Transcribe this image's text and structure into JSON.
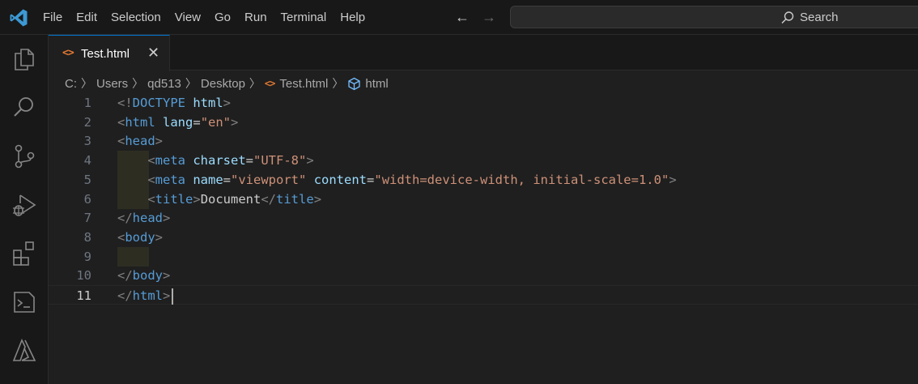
{
  "menu": [
    "File",
    "Edit",
    "Selection",
    "View",
    "Go",
    "Run",
    "Terminal",
    "Help"
  ],
  "search": {
    "label": "Search"
  },
  "activity_bar": [
    "explorer-icon",
    "search-icon",
    "source-control-icon",
    "run-debug-icon",
    "extensions-icon",
    "terminal-icon",
    "azure-icon"
  ],
  "tab": {
    "label": "Test.html",
    "close": "✕"
  },
  "breadcrumb": {
    "drive": "C:",
    "users": "Users",
    "user": "qd513",
    "folder": "Desktop",
    "file": "Test.html",
    "symbol": "html"
  },
  "editor": {
    "current_line": 11,
    "line_numbers": [
      "1",
      "2",
      "3",
      "4",
      "5",
      "6",
      "7",
      "8",
      "9",
      "10",
      "11"
    ],
    "lines": [
      [
        [
          "p",
          "<!"
        ],
        [
          "t",
          "DOCTYPE"
        ],
        [
          "x",
          " "
        ],
        [
          "a",
          "html"
        ],
        [
          "p",
          ">"
        ]
      ],
      [
        [
          "p",
          "<"
        ],
        [
          "t",
          "html"
        ],
        [
          "x",
          " "
        ],
        [
          "a",
          "lang"
        ],
        [
          "x",
          "="
        ],
        [
          "s",
          "\"en\""
        ],
        [
          "p",
          ">"
        ]
      ],
      [
        [
          "p",
          "<"
        ],
        [
          "t",
          "head"
        ],
        [
          "p",
          ">"
        ]
      ],
      [
        [
          "x",
          "    "
        ],
        [
          "p",
          "<"
        ],
        [
          "t",
          "meta"
        ],
        [
          "x",
          " "
        ],
        [
          "a",
          "charset"
        ],
        [
          "x",
          "="
        ],
        [
          "s",
          "\"UTF-8\""
        ],
        [
          "p",
          ">"
        ]
      ],
      [
        [
          "x",
          "    "
        ],
        [
          "p",
          "<"
        ],
        [
          "t",
          "meta"
        ],
        [
          "x",
          " "
        ],
        [
          "a",
          "name"
        ],
        [
          "x",
          "="
        ],
        [
          "s",
          "\"viewport\""
        ],
        [
          "x",
          " "
        ],
        [
          "a",
          "content"
        ],
        [
          "x",
          "="
        ],
        [
          "s",
          "\"width=device-width, initial-scale=1.0\""
        ],
        [
          "p",
          ">"
        ]
      ],
      [
        [
          "x",
          "    "
        ],
        [
          "p",
          "<"
        ],
        [
          "t",
          "title"
        ],
        [
          "p",
          ">"
        ],
        [
          "x",
          "Document"
        ],
        [
          "p",
          "</"
        ],
        [
          "t",
          "title"
        ],
        [
          "p",
          ">"
        ]
      ],
      [
        [
          "p",
          "</"
        ],
        [
          "t",
          "head"
        ],
        [
          "p",
          ">"
        ]
      ],
      [
        [
          "p",
          "<"
        ],
        [
          "t",
          "body"
        ],
        [
          "p",
          ">"
        ]
      ],
      [],
      [
        [
          "p",
          "</"
        ],
        [
          "t",
          "body"
        ],
        [
          "p",
          ">"
        ]
      ],
      [
        [
          "p",
          "</"
        ],
        [
          "t",
          "html"
        ],
        [
          "p",
          ">"
        ]
      ]
    ]
  },
  "colors": {
    "accent": "#0078d4",
    "vscode_logo": "#3c99d4",
    "tag": "#569cd6",
    "attribute": "#9cdcfe",
    "string": "#ce9178",
    "punctuation": "#808080",
    "html_file_icon": "#e37933"
  }
}
